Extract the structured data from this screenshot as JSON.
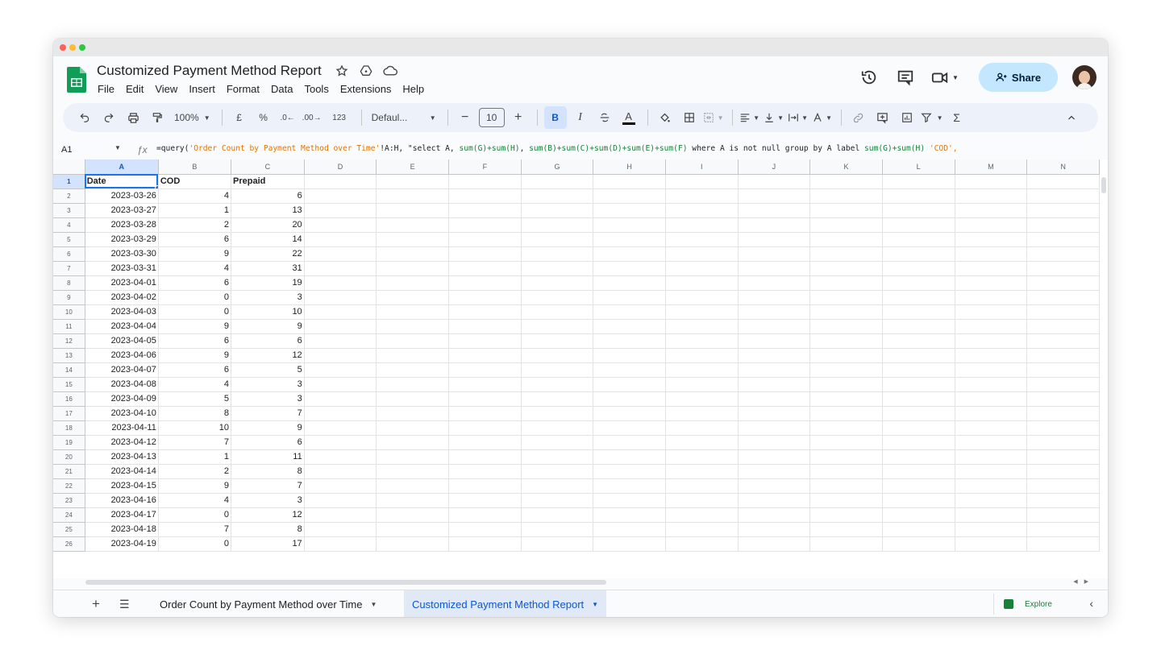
{
  "doc_title": "Customized Payment Method Report",
  "menu": [
    "File",
    "Edit",
    "View",
    "Insert",
    "Format",
    "Data",
    "Tools",
    "Extensions",
    "Help"
  ],
  "share_label": "Share",
  "toolbar": {
    "zoom": "100%",
    "currency": "£",
    "percent": "%",
    "dec_decrease": ".0←",
    "dec_increase": ".00→",
    "number_format": "123",
    "font": "Defaul...",
    "font_size": "10",
    "bold": "B",
    "italic": "I",
    "text_color": "A"
  },
  "name_box": "A1",
  "formula": {
    "prefix": "=query(",
    "sheet_ref": "'Order Count by Payment Method over Time'",
    "range_part": "!A:H, \"select A, ",
    "sum1": "sum(G)+sum(H)",
    "mid1": ", ",
    "sum2": "sum(B)+sum(C)+sum(D)+sum(E)+sum(F)",
    "mid2": " where A is not null group by A label ",
    "sum3": "sum(G)+sum(H)",
    "tail": " 'COD',"
  },
  "columns": [
    "A",
    "B",
    "C",
    "D",
    "E",
    "F",
    "G",
    "H",
    "I",
    "J",
    "K",
    "L",
    "M",
    "N"
  ],
  "header_row": [
    "Date",
    "COD",
    "Prepaid"
  ],
  "rows": [
    [
      "2023-03-26",
      "4",
      "6"
    ],
    [
      "2023-03-27",
      "1",
      "13"
    ],
    [
      "2023-03-28",
      "2",
      "20"
    ],
    [
      "2023-03-29",
      "6",
      "14"
    ],
    [
      "2023-03-30",
      "9",
      "22"
    ],
    [
      "2023-03-31",
      "4",
      "31"
    ],
    [
      "2023-04-01",
      "6",
      "19"
    ],
    [
      "2023-04-02",
      "0",
      "3"
    ],
    [
      "2023-04-03",
      "0",
      "10"
    ],
    [
      "2023-04-04",
      "9",
      "9"
    ],
    [
      "2023-04-05",
      "6",
      "6"
    ],
    [
      "2023-04-06",
      "9",
      "12"
    ],
    [
      "2023-04-07",
      "6",
      "5"
    ],
    [
      "2023-04-08",
      "4",
      "3"
    ],
    [
      "2023-04-09",
      "5",
      "3"
    ],
    [
      "2023-04-10",
      "8",
      "7"
    ],
    [
      "2023-04-11",
      "10",
      "9"
    ],
    [
      "2023-04-12",
      "7",
      "6"
    ],
    [
      "2023-04-13",
      "1",
      "11"
    ],
    [
      "2023-04-14",
      "2",
      "8"
    ],
    [
      "2023-04-15",
      "9",
      "7"
    ],
    [
      "2023-04-16",
      "4",
      "3"
    ],
    [
      "2023-04-17",
      "0",
      "12"
    ],
    [
      "2023-04-18",
      "7",
      "8"
    ],
    [
      "2023-04-19",
      "0",
      "17"
    ]
  ],
  "tabs": {
    "tab1": "Order Count by Payment Method over Time",
    "tab2": "Customized Payment Method Report"
  },
  "explore_label": "Explore",
  "colors": {
    "accent": "#0b57d0",
    "share_bg": "#c2e7ff",
    "toolbar_bg": "#edf2fa",
    "sheets_green": "#188038"
  }
}
